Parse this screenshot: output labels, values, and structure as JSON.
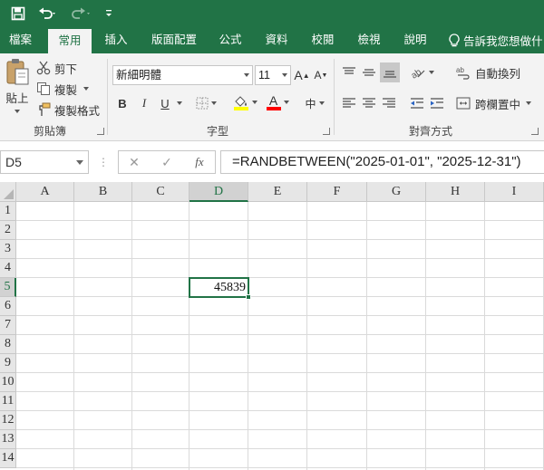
{
  "tabs": [
    {
      "label": "檔案",
      "active": false
    },
    {
      "label": "常用",
      "active": true
    },
    {
      "label": "插入",
      "active": false
    },
    {
      "label": "版面配置",
      "active": false
    },
    {
      "label": "公式",
      "active": false
    },
    {
      "label": "資料",
      "active": false
    },
    {
      "label": "校閱",
      "active": false
    },
    {
      "label": "檢視",
      "active": false
    },
    {
      "label": "說明",
      "active": false
    }
  ],
  "tell_me": "告訴我您想做什",
  "clipboard": {
    "paste_label": "貼上",
    "cut_label": "剪下",
    "copy_label": "複製",
    "format_painter_label": "複製格式",
    "group_label": "剪貼簿"
  },
  "font": {
    "name": "新細明體",
    "size": "11",
    "grow_label": "A",
    "shrink_label": "A",
    "bold": "B",
    "italic": "I",
    "underline": "U",
    "font_color_letter": "A",
    "phonetic_label": "中",
    "group_label": "字型",
    "highlight_color": "#ffff00",
    "font_color": "#ff0000"
  },
  "alignment": {
    "wrap_text_label": "自動換列",
    "merge_center_label": "跨欄置中",
    "group_label": "對齊方式"
  },
  "formula_bar": {
    "name_box": "D5",
    "cancel_symbol": "✕",
    "enter_symbol": "✓",
    "fx_label": "fx",
    "formula": "=RANDBETWEEN(\"2025-01-01\", \"2025-12-31\")"
  },
  "sheet": {
    "columns": [
      "A",
      "B",
      "C",
      "D",
      "E",
      "F",
      "G",
      "H",
      "I"
    ],
    "rows": [
      "1",
      "2",
      "3",
      "4",
      "5",
      "6",
      "7",
      "8",
      "9",
      "10",
      "11",
      "12",
      "13",
      "14"
    ],
    "selected_column": "D",
    "selected_row": "5",
    "active_cell_value": "45839"
  },
  "colors": {
    "brand": "#217346",
    "ribbon_bg": "#f3f3f3",
    "header_bg": "#e6e6e6"
  }
}
